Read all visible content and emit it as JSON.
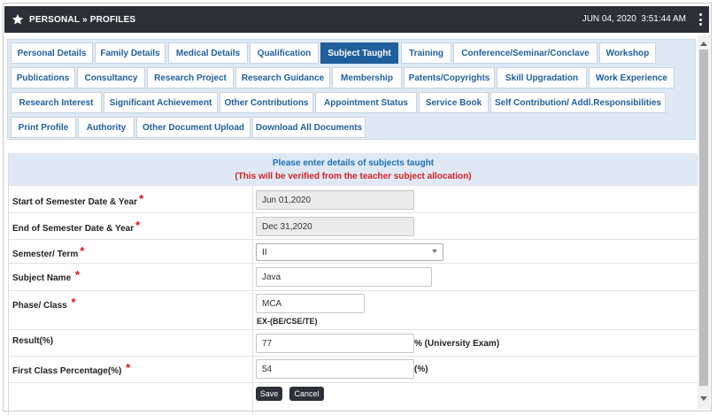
{
  "header": {
    "breadcrumb": "PERSONAL » PROFILES",
    "date": "JUN 04, 2020",
    "time": "3:51:44 AM"
  },
  "tabs": [
    "Personal Details",
    "Family Details",
    "Medical Details",
    "Qualification",
    "Subject Taught",
    "Training",
    "Conference/Seminar/Conclave",
    "Workshop",
    "Publications",
    "Consultancy",
    "Research Project",
    "Research Guidance",
    "Membership",
    "Patents/Copyrights",
    "Skill Upgradation",
    "Work Experience",
    "Research Interest",
    "Significant Achievement",
    "Other Contributions",
    "Appointment Status",
    "Service Book",
    "Self Contribution/ Addl.Responsibilities",
    "Print Profile",
    "Authority",
    "Other Document Upload",
    "Download All Documents"
  ],
  "active_tab": "Subject Taught",
  "notice": {
    "line1": "Please enter details of subjects taught",
    "line2": "(This will be verified from the teacher subject allocation)"
  },
  "form": {
    "start_label": "Start of Semester Date & Year",
    "start_value": "Jun 01,2020",
    "end_label": "End of Semester Date & Year",
    "end_value": "Dec 31,2020",
    "semester_label": "Semester/ Term",
    "semester_value": "II",
    "subject_label": "Subject Name",
    "subject_value": "Java",
    "phase_label": "Phase/ Class",
    "phase_value": "MCA",
    "phase_hint": "EX-(BE/CSE/TE)",
    "result_label": "Result(%)",
    "result_value": "77",
    "result_suffix": "%  (University Exam)",
    "firstclass_label": "First Class Percentage(%)",
    "firstclass_value": "54",
    "firstclass_suffix": "(%)",
    "required_mark": "*"
  },
  "buttons": {
    "save": "Save",
    "cancel": "Cancel"
  },
  "colors": {
    "topbar": "#2c2f35",
    "tab_active": "#1f5f9b",
    "tab_panel": "#dfe9f6",
    "required": "#e01010",
    "notice_blue": "#1f6fb5",
    "notice_red": "#d62020"
  },
  "icons": {
    "header": "star-icon",
    "menu": "kebab-menu-icon"
  }
}
